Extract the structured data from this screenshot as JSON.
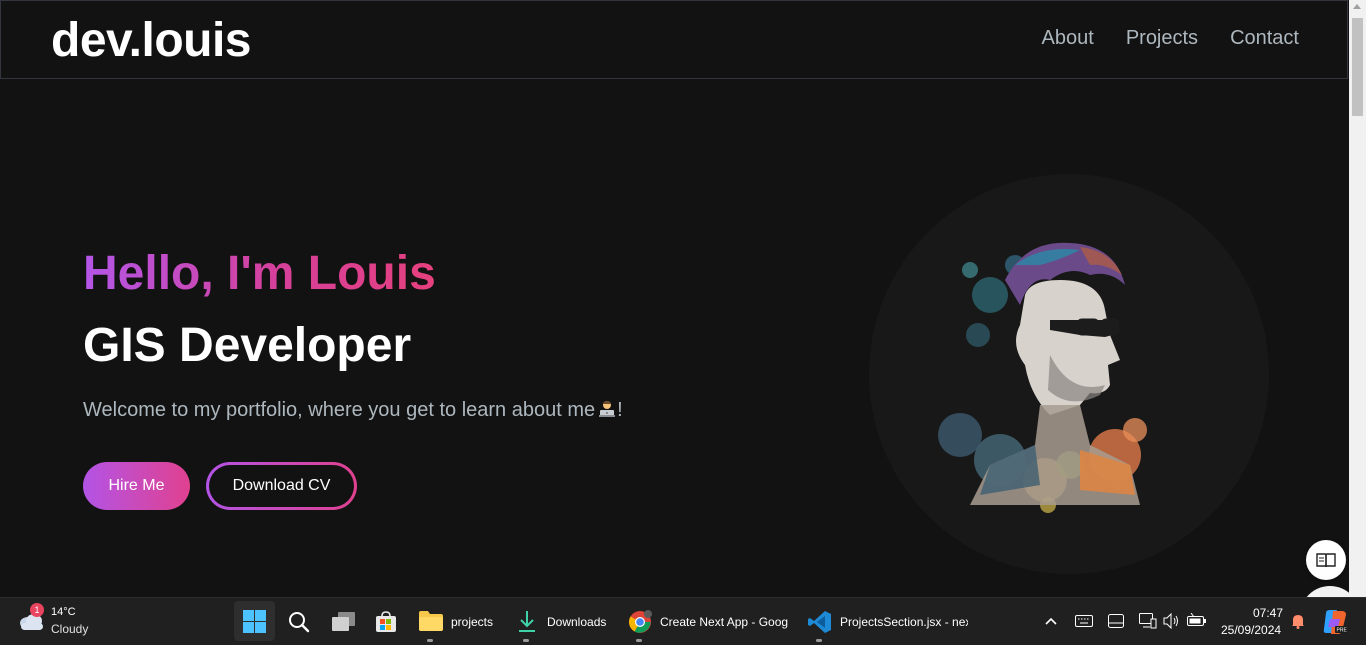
{
  "nav": {
    "logo": "dev.louis",
    "links": [
      "About",
      "Projects",
      "Contact"
    ]
  },
  "hero": {
    "greeting": "Hello, I'm Louis",
    "role": "GIS Developer",
    "description": "Welcome to my portfolio, where you get to learn about me",
    "description_suffix": "!",
    "hire_button": "Hire Me",
    "cv_button": "Download CV"
  },
  "colors": {
    "background": "#121212",
    "gradient_start": "#b354e6",
    "gradient_end": "#e0418f",
    "muted_text": "#ADB7BE"
  },
  "icons": {
    "emoji": "technologist-emoji",
    "reader": "immersive-reader-icon"
  },
  "taskbar": {
    "weather": {
      "temp": "14°C",
      "condition": "Cloudy",
      "badge": "1"
    },
    "apps": [
      {
        "label": "projects"
      },
      {
        "label": "Downloads"
      },
      {
        "label": "Create Next App - Goog"
      },
      {
        "label": "ProjectsSection.jsx - nex"
      }
    ],
    "clock": {
      "time": "07:47",
      "date": "25/09/2024"
    }
  }
}
